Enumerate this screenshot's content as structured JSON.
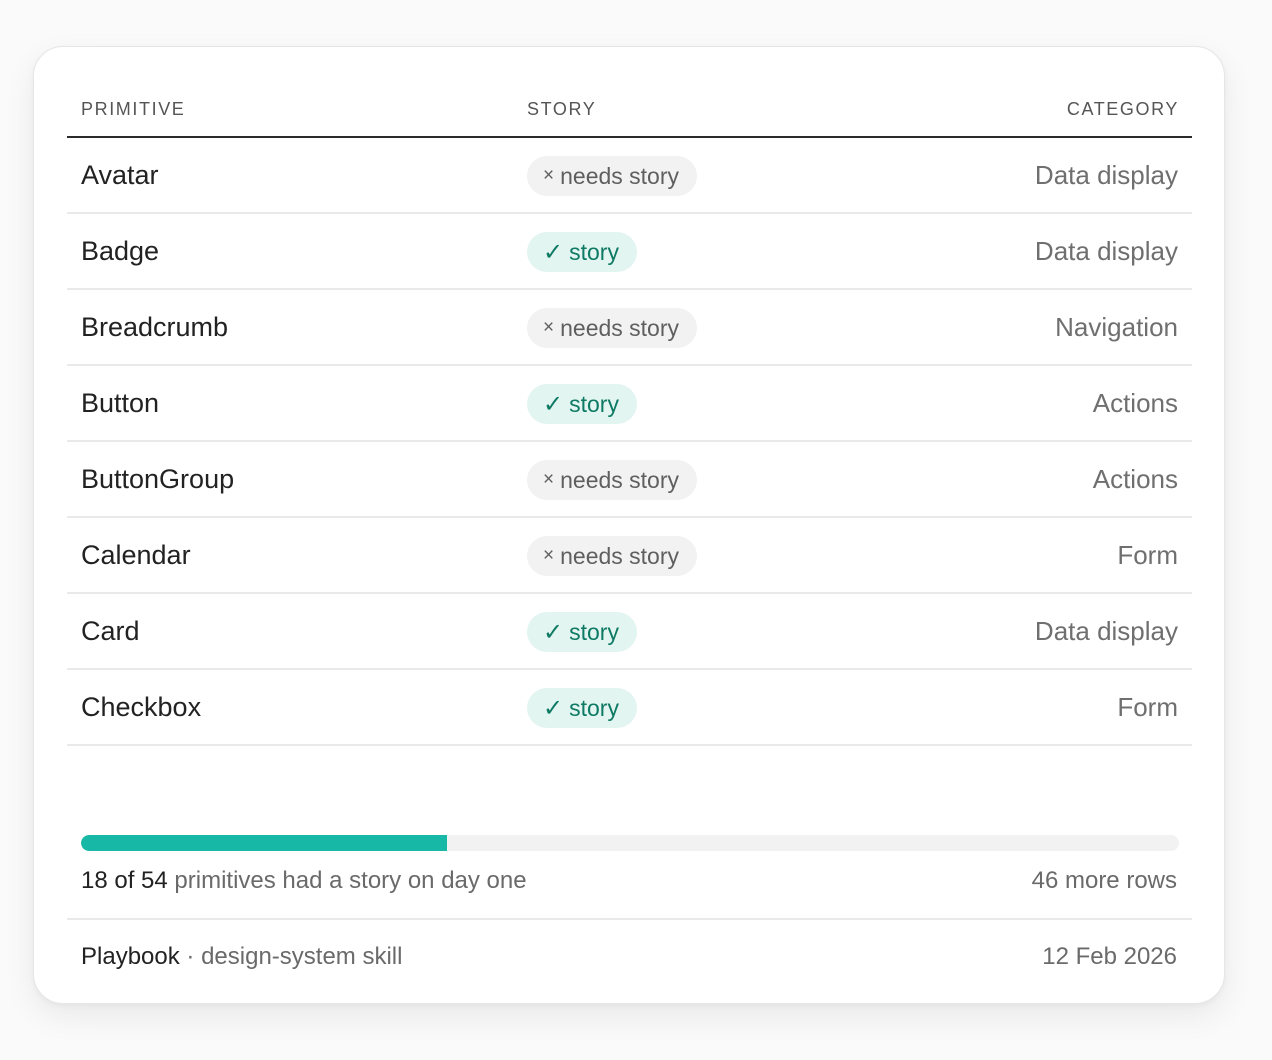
{
  "table": {
    "headers": [
      "PRIMITIVE",
      "STORY",
      "CATEGORY"
    ],
    "rows": [
      {
        "name": "Avatar",
        "story_status": "missing",
        "story_glyph": "×",
        "story_label": "needs story",
        "category": "Data display"
      },
      {
        "name": "Badge",
        "story_status": "ok",
        "story_glyph": "✓",
        "story_label": "story",
        "category": "Data display"
      },
      {
        "name": "Breadcrumb",
        "story_status": "missing",
        "story_glyph": "×",
        "story_label": "needs story",
        "category": "Navigation"
      },
      {
        "name": "Button",
        "story_status": "ok",
        "story_glyph": "✓",
        "story_label": "story",
        "category": "Actions"
      },
      {
        "name": "ButtonGroup",
        "story_status": "missing",
        "story_glyph": "×",
        "story_label": "needs story",
        "category": "Actions"
      },
      {
        "name": "Calendar",
        "story_status": "missing",
        "story_glyph": "×",
        "story_label": "needs story",
        "category": "Form"
      },
      {
        "name": "Card",
        "story_status": "ok",
        "story_glyph": "✓",
        "story_label": "story",
        "category": "Data display"
      },
      {
        "name": "Checkbox",
        "story_status": "ok",
        "story_glyph": "✓",
        "story_label": "story",
        "category": "Form"
      }
    ]
  },
  "progress": {
    "count": 18,
    "total": 54,
    "fraction": 0.3333,
    "strong_text": "18 of 54",
    "rest_text": " primitives had a story on day one",
    "more_rows": "46 more rows"
  },
  "footer": {
    "brand": "Playbook",
    "tagline": " · design-system skill",
    "date": "12 Feb 2026"
  },
  "colors": {
    "accent": "#17b8a6",
    "ok_bg": "#e3f5f1",
    "ok_text": "#0e7a64",
    "missing_bg": "#f2f2f3",
    "missing_text": "#5f5f5f"
  }
}
